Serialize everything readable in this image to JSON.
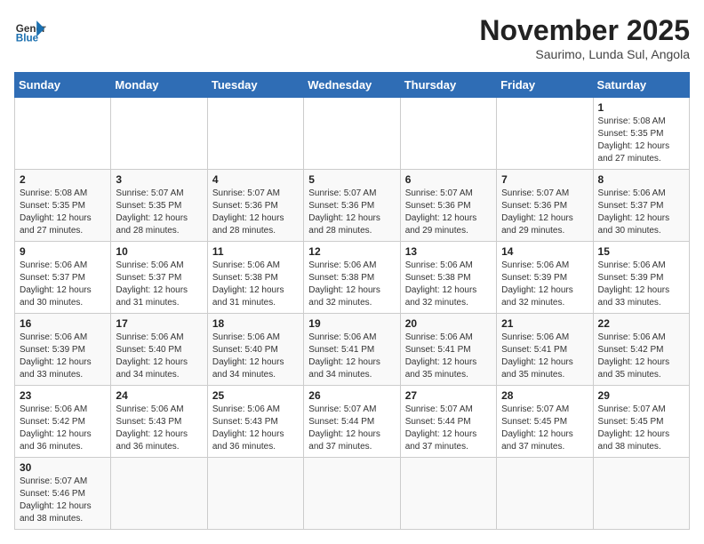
{
  "header": {
    "logo_text_general": "General",
    "logo_text_blue": "Blue",
    "month_title": "November 2025",
    "subtitle": "Saurimo, Lunda Sul, Angola"
  },
  "days_of_week": [
    "Sunday",
    "Monday",
    "Tuesday",
    "Wednesday",
    "Thursday",
    "Friday",
    "Saturday"
  ],
  "weeks": [
    {
      "cells": [
        {
          "day": null,
          "info": null
        },
        {
          "day": null,
          "info": null
        },
        {
          "day": null,
          "info": null
        },
        {
          "day": null,
          "info": null
        },
        {
          "day": null,
          "info": null
        },
        {
          "day": null,
          "info": null
        },
        {
          "day": "1",
          "info": "Sunrise: 5:08 AM\nSunset: 5:35 PM\nDaylight: 12 hours and 27 minutes."
        }
      ]
    },
    {
      "cells": [
        {
          "day": "2",
          "info": "Sunrise: 5:08 AM\nSunset: 5:35 PM\nDaylight: 12 hours and 27 minutes."
        },
        {
          "day": "3",
          "info": "Sunrise: 5:07 AM\nSunset: 5:35 PM\nDaylight: 12 hours and 28 minutes."
        },
        {
          "day": "4",
          "info": "Sunrise: 5:07 AM\nSunset: 5:36 PM\nDaylight: 12 hours and 28 minutes."
        },
        {
          "day": "5",
          "info": "Sunrise: 5:07 AM\nSunset: 5:36 PM\nDaylight: 12 hours and 28 minutes."
        },
        {
          "day": "6",
          "info": "Sunrise: 5:07 AM\nSunset: 5:36 PM\nDaylight: 12 hours and 29 minutes."
        },
        {
          "day": "7",
          "info": "Sunrise: 5:07 AM\nSunset: 5:36 PM\nDaylight: 12 hours and 29 minutes."
        },
        {
          "day": "8",
          "info": "Sunrise: 5:06 AM\nSunset: 5:37 PM\nDaylight: 12 hours and 30 minutes."
        }
      ]
    },
    {
      "cells": [
        {
          "day": "9",
          "info": "Sunrise: 5:06 AM\nSunset: 5:37 PM\nDaylight: 12 hours and 30 minutes."
        },
        {
          "day": "10",
          "info": "Sunrise: 5:06 AM\nSunset: 5:37 PM\nDaylight: 12 hours and 31 minutes."
        },
        {
          "day": "11",
          "info": "Sunrise: 5:06 AM\nSunset: 5:38 PM\nDaylight: 12 hours and 31 minutes."
        },
        {
          "day": "12",
          "info": "Sunrise: 5:06 AM\nSunset: 5:38 PM\nDaylight: 12 hours and 32 minutes."
        },
        {
          "day": "13",
          "info": "Sunrise: 5:06 AM\nSunset: 5:38 PM\nDaylight: 12 hours and 32 minutes."
        },
        {
          "day": "14",
          "info": "Sunrise: 5:06 AM\nSunset: 5:39 PM\nDaylight: 12 hours and 32 minutes."
        },
        {
          "day": "15",
          "info": "Sunrise: 5:06 AM\nSunset: 5:39 PM\nDaylight: 12 hours and 33 minutes."
        }
      ]
    },
    {
      "cells": [
        {
          "day": "16",
          "info": "Sunrise: 5:06 AM\nSunset: 5:39 PM\nDaylight: 12 hours and 33 minutes."
        },
        {
          "day": "17",
          "info": "Sunrise: 5:06 AM\nSunset: 5:40 PM\nDaylight: 12 hours and 34 minutes."
        },
        {
          "day": "18",
          "info": "Sunrise: 5:06 AM\nSunset: 5:40 PM\nDaylight: 12 hours and 34 minutes."
        },
        {
          "day": "19",
          "info": "Sunrise: 5:06 AM\nSunset: 5:41 PM\nDaylight: 12 hours and 34 minutes."
        },
        {
          "day": "20",
          "info": "Sunrise: 5:06 AM\nSunset: 5:41 PM\nDaylight: 12 hours and 35 minutes."
        },
        {
          "day": "21",
          "info": "Sunrise: 5:06 AM\nSunset: 5:41 PM\nDaylight: 12 hours and 35 minutes."
        },
        {
          "day": "22",
          "info": "Sunrise: 5:06 AM\nSunset: 5:42 PM\nDaylight: 12 hours and 35 minutes."
        }
      ]
    },
    {
      "cells": [
        {
          "day": "23",
          "info": "Sunrise: 5:06 AM\nSunset: 5:42 PM\nDaylight: 12 hours and 36 minutes."
        },
        {
          "day": "24",
          "info": "Sunrise: 5:06 AM\nSunset: 5:43 PM\nDaylight: 12 hours and 36 minutes."
        },
        {
          "day": "25",
          "info": "Sunrise: 5:06 AM\nSunset: 5:43 PM\nDaylight: 12 hours and 36 minutes."
        },
        {
          "day": "26",
          "info": "Sunrise: 5:07 AM\nSunset: 5:44 PM\nDaylight: 12 hours and 37 minutes."
        },
        {
          "day": "27",
          "info": "Sunrise: 5:07 AM\nSunset: 5:44 PM\nDaylight: 12 hours and 37 minutes."
        },
        {
          "day": "28",
          "info": "Sunrise: 5:07 AM\nSunset: 5:45 PM\nDaylight: 12 hours and 37 minutes."
        },
        {
          "day": "29",
          "info": "Sunrise: 5:07 AM\nSunset: 5:45 PM\nDaylight: 12 hours and 38 minutes."
        }
      ]
    },
    {
      "cells": [
        {
          "day": "30",
          "info": "Sunrise: 5:07 AM\nSunset: 5:46 PM\nDaylight: 12 hours and 38 minutes."
        },
        {
          "day": null,
          "info": null
        },
        {
          "day": null,
          "info": null
        },
        {
          "day": null,
          "info": null
        },
        {
          "day": null,
          "info": null
        },
        {
          "day": null,
          "info": null
        },
        {
          "day": null,
          "info": null
        }
      ]
    }
  ]
}
